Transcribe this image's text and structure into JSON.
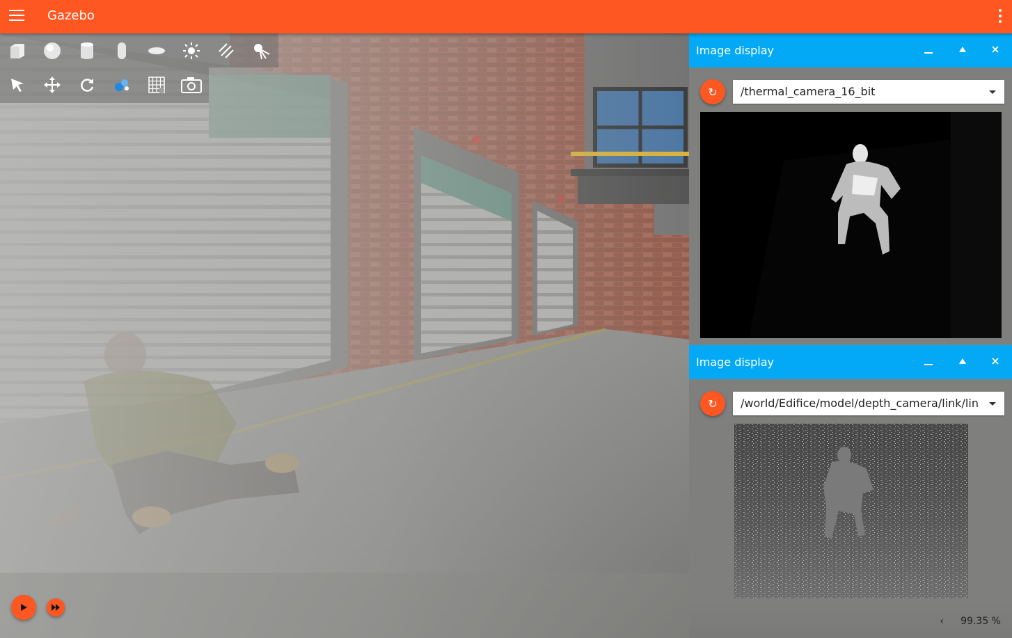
{
  "app": {
    "title": "Gazebo"
  },
  "toolbar": {
    "shapes": [
      "box-icon",
      "sphere-icon",
      "cylinder-icon",
      "capsule-icon",
      "ellipsoid-icon",
      "sun-light-icon",
      "directional-light-icon",
      "spot-light-icon"
    ],
    "transform": [
      "select-arrow-icon",
      "translate-icon",
      "rotate-icon",
      "scale-icon",
      "grid-icon",
      "screenshot-camera-icon"
    ]
  },
  "panels": [
    {
      "title": "Image display",
      "topic": "/thermal_camera_16_bit"
    },
    {
      "title": "Image display",
      "topic": "/world/Edifice/model/depth_camera/link/lin"
    }
  ],
  "status": {
    "rtf": "99.35 %"
  },
  "colors": {
    "header": "#ff5722",
    "panel_header": "#03a9f4",
    "accent": "#ff5722"
  }
}
